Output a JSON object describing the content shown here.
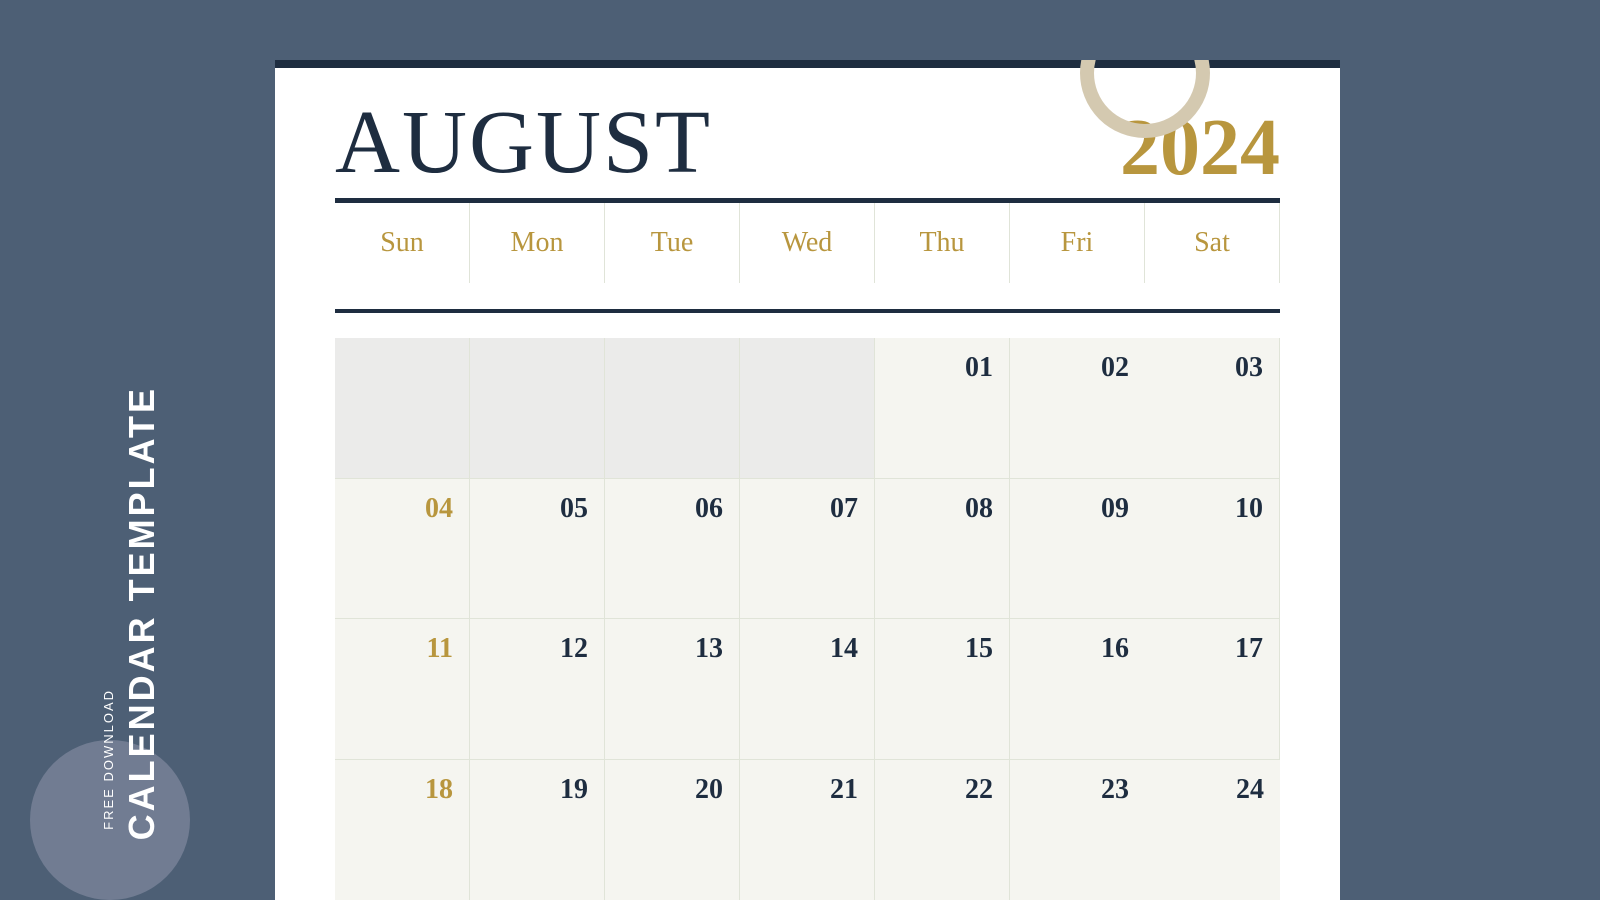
{
  "sidebar": {
    "free_download_label": "FREE DOWNLOAD",
    "calendar_template_label": "CALENDAR TEMPLATE"
  },
  "header": {
    "month": "AUGUST",
    "year": "2024"
  },
  "days_of_week": [
    "Sun",
    "Mon",
    "Tue",
    "Wed",
    "Thu",
    "Fri",
    "Sat"
  ],
  "weeks": [
    [
      {
        "day": "",
        "empty": true,
        "sunday": false
      },
      {
        "day": "",
        "empty": true,
        "sunday": false
      },
      {
        "day": "",
        "empty": true,
        "sunday": false
      },
      {
        "day": "",
        "empty": true,
        "sunday": false
      },
      {
        "day": "01",
        "empty": false,
        "sunday": false
      },
      {
        "day": "02",
        "empty": false,
        "sunday": false
      },
      {
        "day": "03",
        "empty": false,
        "sunday": false
      }
    ],
    [
      {
        "day": "04",
        "empty": false,
        "sunday": true
      },
      {
        "day": "05",
        "empty": false,
        "sunday": false
      },
      {
        "day": "06",
        "empty": false,
        "sunday": false
      },
      {
        "day": "07",
        "empty": false,
        "sunday": false
      },
      {
        "day": "08",
        "empty": false,
        "sunday": false
      },
      {
        "day": "09",
        "empty": false,
        "sunday": false
      },
      {
        "day": "10",
        "empty": false,
        "sunday": false
      }
    ],
    [
      {
        "day": "11",
        "empty": false,
        "sunday": true
      },
      {
        "day": "12",
        "empty": false,
        "sunday": false
      },
      {
        "day": "13",
        "empty": false,
        "sunday": false
      },
      {
        "day": "14",
        "empty": false,
        "sunday": false
      },
      {
        "day": "15",
        "empty": false,
        "sunday": false
      },
      {
        "day": "16",
        "empty": false,
        "sunday": false
      },
      {
        "day": "17",
        "empty": false,
        "sunday": false
      }
    ],
    [
      {
        "day": "18",
        "empty": false,
        "sunday": true
      },
      {
        "day": "19",
        "empty": false,
        "sunday": false
      },
      {
        "day": "20",
        "empty": false,
        "sunday": false
      },
      {
        "day": "21",
        "empty": false,
        "sunday": false
      },
      {
        "day": "22",
        "empty": false,
        "sunday": false
      },
      {
        "day": "23",
        "empty": false,
        "sunday": false
      },
      {
        "day": "24",
        "empty": false,
        "sunday": false
      }
    ]
  ],
  "colors": {
    "background": "#4d5f75",
    "calendar_bg": "#ffffff",
    "top_bar": "#1e2d40",
    "month_color": "#1e2d40",
    "year_color": "#b8963e",
    "day_header_color": "#b8963e",
    "day_number_color": "#1e2d40",
    "sunday_color": "#b8963e",
    "cell_bg": "#f5f5f0",
    "empty_cell_bg": "#ebebea"
  }
}
